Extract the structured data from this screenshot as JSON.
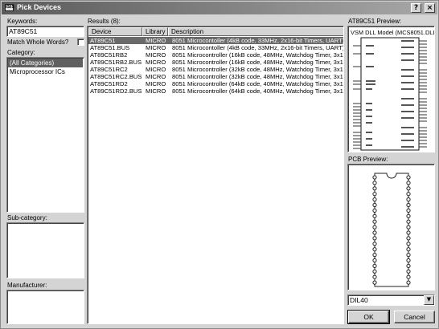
{
  "window": {
    "title": "Pick Devices",
    "icon": "pick-devices-icon",
    "help_label": "?",
    "close_label": "×"
  },
  "keywords": {
    "label": "Keywords:",
    "value": "AT89C51"
  },
  "match_whole_words": {
    "label": "Match Whole Words?",
    "checked": false
  },
  "category": {
    "label": "Category:",
    "items": [
      {
        "label": "(All Categories)",
        "selected": true
      },
      {
        "label": "Microprocessor ICs",
        "selected": false
      }
    ]
  },
  "subcategory": {
    "label": "Sub-category:"
  },
  "manufacturer": {
    "label": "Manufacturer:"
  },
  "results": {
    "label": "Results (8):",
    "columns": [
      "Device",
      "Library",
      "Description"
    ],
    "rows": [
      {
        "device": "AT89C51",
        "library": "MICRO",
        "description": "8051 Microcontoller (4kB code, 33MHz, 2x16-bit Timers, UART)",
        "selected": true
      },
      {
        "device": "AT89C51.BUS",
        "library": "MICRO",
        "description": "8051 Microcontoller (4kB code, 33MHz, 2x16-bit Timers, UART)"
      },
      {
        "device": "AT89C51RB2",
        "library": "MICRO",
        "description": "8051 Microcontroller (16kB code, 48MHz, Watchdog Timer, 3x16-b"
      },
      {
        "device": "AT89C51RB2.BUS",
        "library": "MICRO",
        "description": "8051 Microcontroller (16kB code, 48MHz, Watchdog Timer, 3x16-b"
      },
      {
        "device": "AT89C51RC2",
        "library": "MICRO",
        "description": "8051 Microcontroller (32kB code, 48MHz, Watchdog Timer, 3x16-b"
      },
      {
        "device": "AT89C51RC2.BUS",
        "library": "MICRO",
        "description": "8051 Microcontroller (32kB code, 48MHz, Watchdog Timer, 3x16-b"
      },
      {
        "device": "AT89C51RD2",
        "library": "MICRO",
        "description": "8051 Microcontroller (64kB code, 40MHz, Watchdog Timer, 3x16-b"
      },
      {
        "device": "AT89C51RD2.BUS",
        "library": "MICRO",
        "description": "8051 Microcontroller (64kB code, 40MHz, Watchdog Timer, 3x16-b"
      }
    ]
  },
  "preview": {
    "label": "AT89C51 Preview:",
    "model_text": "VSM DLL Model (MCS8051.DLL"
  },
  "pcb_preview": {
    "label": "PCB Preview:"
  },
  "package": {
    "value": "DIL40"
  },
  "buttons": {
    "ok": "OK",
    "cancel": "Cancel"
  }
}
